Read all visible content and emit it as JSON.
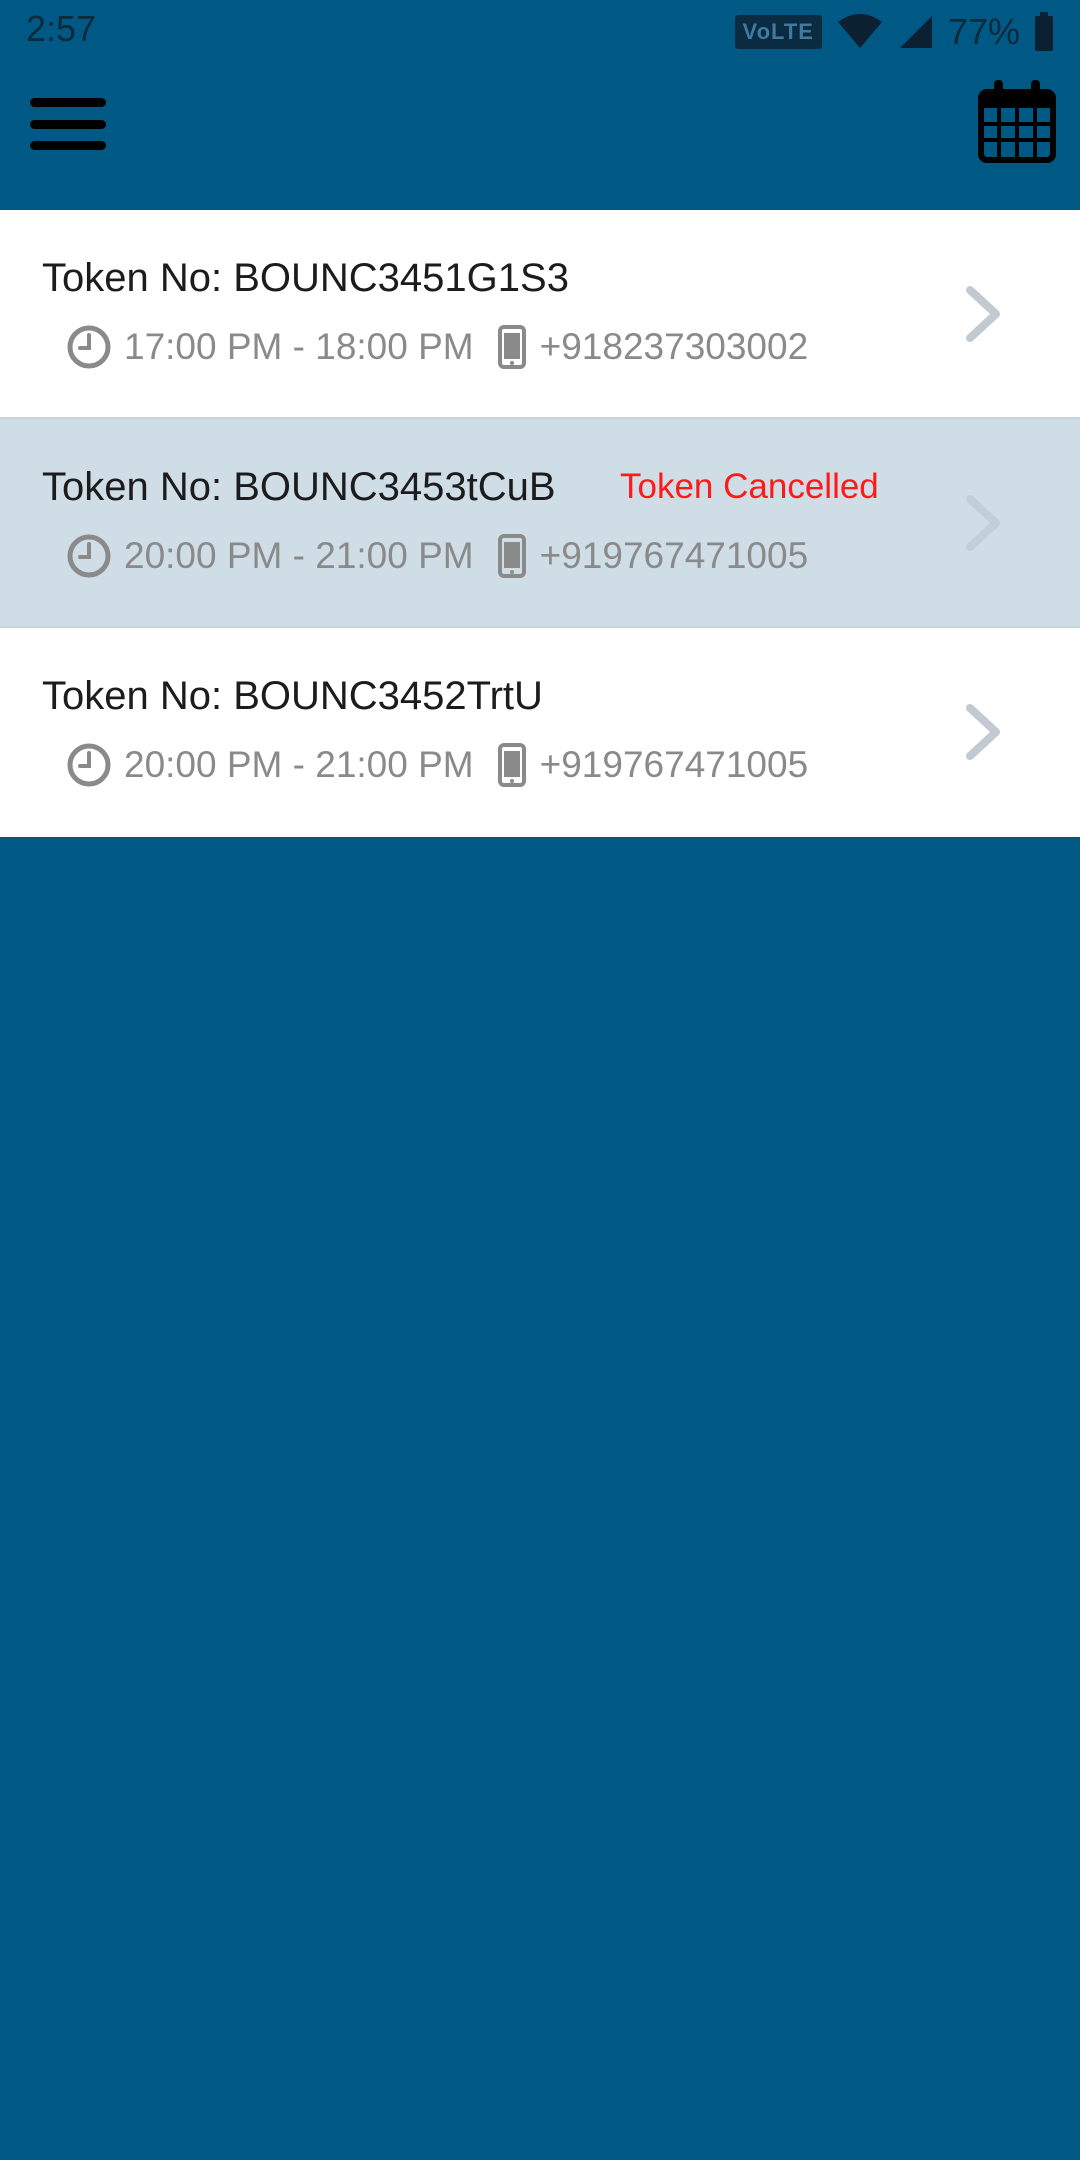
{
  "status_bar": {
    "time": "2:57",
    "network_badge": "VoLTE",
    "battery_percent": "77%"
  },
  "app_bar": {
    "menu_icon": "hamburger-menu-icon",
    "calendar_icon": "calendar-icon"
  },
  "tokens": [
    {
      "title": "Token No: BOUNC3451G1S3",
      "status": "",
      "time_range": "17:00 PM - 18:00 PM",
      "phone": "+918237303002",
      "cancelled": false
    },
    {
      "title": "Token No: BOUNC3453tCuB",
      "status": "Token Cancelled",
      "time_range": "20:00 PM - 21:00 PM",
      "phone": "+919767471005",
      "cancelled": true
    },
    {
      "title": "Token No: BOUNC3452TrtU",
      "status": "",
      "time_range": "20:00 PM - 21:00 PM",
      "phone": "+919767471005",
      "cancelled": false
    }
  ],
  "colors": {
    "background": "#005985",
    "row_default": "#ffffff",
    "row_cancelled": "#cfdde6",
    "cancelled_text": "#ff1a1a",
    "meta_text": "#8a8a8a"
  }
}
